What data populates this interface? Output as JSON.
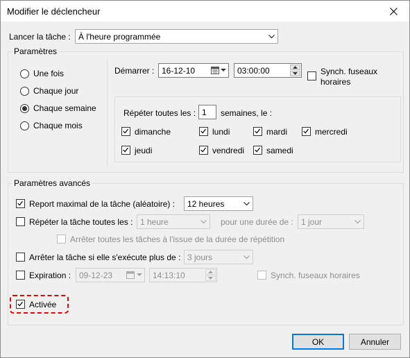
{
  "window": {
    "title": "Modifier le déclencheur"
  },
  "launch": {
    "label": "Lancer la tâche :",
    "value": "À l'heure programmée"
  },
  "settings": {
    "legend": "Paramètres",
    "frequency": [
      {
        "label": "Une fois",
        "selected": false
      },
      {
        "label": "Chaque jour",
        "selected": false
      },
      {
        "label": "Chaque semaine",
        "selected": true
      },
      {
        "label": "Chaque mois",
        "selected": false
      }
    ],
    "start": {
      "label": "Démarrer :",
      "date": "16-12-10",
      "time": "03:00:00"
    },
    "sync_tz": {
      "label_line1": "Synch. fuseaux",
      "label_line2": "horaires",
      "checked": false
    },
    "repeat": {
      "label": "Répéter toutes les :",
      "value": "1",
      "suffix": "semaines, le :"
    },
    "days": [
      {
        "label": "dimanche",
        "checked": true
      },
      {
        "label": "lundi",
        "checked": true
      },
      {
        "label": "mardi",
        "checked": true
      },
      {
        "label": "mercredi",
        "checked": true
      },
      {
        "label": "jeudi",
        "checked": true
      },
      {
        "label": "vendredi",
        "checked": true
      },
      {
        "label": "samedi",
        "checked": true
      }
    ]
  },
  "advanced": {
    "legend": "Paramètres avancés",
    "delay": {
      "label": "Report maximal de la tâche (aléatoire) :",
      "checked": true,
      "value": "12 heures"
    },
    "repeat_task": {
      "label": "Répéter la tâche toutes les :",
      "checked": false,
      "value": "1 heure",
      "duration_label": "pour une durée de :",
      "duration_value": "1 jour"
    },
    "stop_all": {
      "label": "Arrêter toutes les tâches à l'issue de la durée de répétition",
      "checked": false
    },
    "stop_if": {
      "label": "Arrêter la tâche si elle s'exécute plus de :",
      "checked": false,
      "value": "3 jours"
    },
    "expiration": {
      "label": "Expiration :",
      "checked": false,
      "date": "09-12-23",
      "time": "14:13:10",
      "sync_label": "Synch. fuseaux horaires",
      "sync_checked": false
    },
    "enabled": {
      "label": "Activée",
      "checked": true
    }
  },
  "buttons": {
    "ok": "OK",
    "cancel": "Annuler"
  },
  "colors": {
    "highlight": "#e00000",
    "accent": "#0078d7"
  }
}
